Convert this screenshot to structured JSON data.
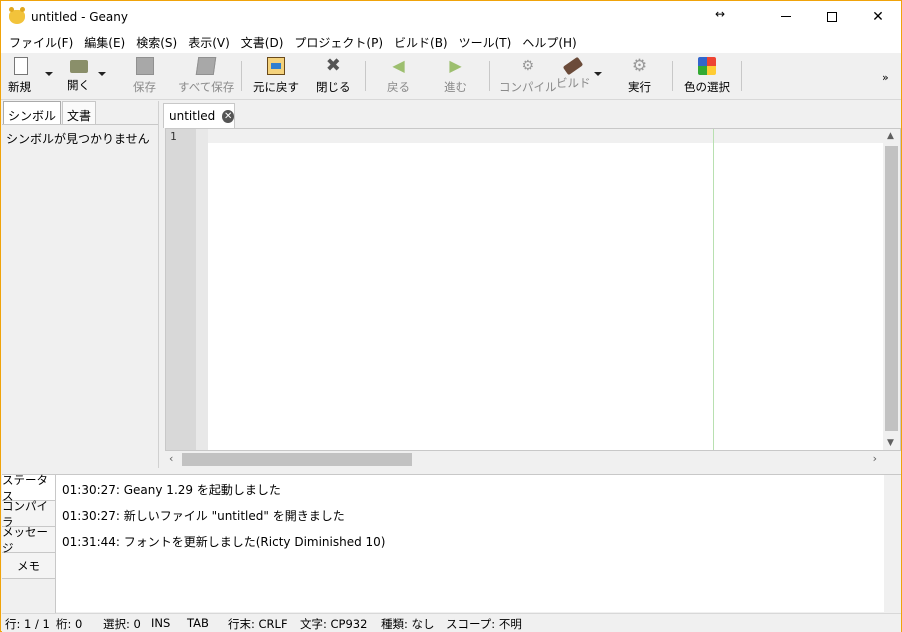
{
  "title": "untitled - Geany",
  "window": {
    "resize_hint": "↔",
    "minimize": "",
    "maximize": "",
    "close": "✕"
  },
  "menu": [
    "ファイル(F)",
    "編集(E)",
    "検索(S)",
    "表示(V)",
    "文書(D)",
    "プロジェクト(P)",
    "ビルド(B)",
    "ツール(T)",
    "ヘルプ(H)"
  ],
  "toolbar": {
    "new": "新規",
    "open": "開く",
    "save": "保存",
    "save_all": "すべて保存",
    "revert": "元に戻す",
    "close": "閉じる",
    "back": "戻る",
    "forward": "進む",
    "compile": "コンパイル",
    "build": "ビルド",
    "run": "実行",
    "color": "色の選択",
    "overflow": "»"
  },
  "sidebar": {
    "tabs": [
      "シンボル",
      "文書"
    ],
    "empty_text": "シンボルが見つかりません"
  },
  "editor": {
    "tab_label": "untitled",
    "line_numbers": [
      "1"
    ]
  },
  "messages": {
    "tabs": [
      "ステータス",
      "コンパイラ",
      "メッセージ",
      "メモ"
    ],
    "lines": [
      "01:30:27: Geany 1.29 を起動しました",
      "01:30:27: 新しいファイル \"untitled\" を開きました",
      "01:31:44: フォントを更新しました(Ricty Diminished 10)"
    ]
  },
  "status": {
    "line": "行: 1 / 1",
    "col": "桁: 0",
    "sel": "選択: 0",
    "ins": "INS",
    "tab": "TAB",
    "eol": "行末: CRLF",
    "enc": "文字: CP932",
    "type": "種類: なし",
    "scope": "スコープ: 不明"
  }
}
